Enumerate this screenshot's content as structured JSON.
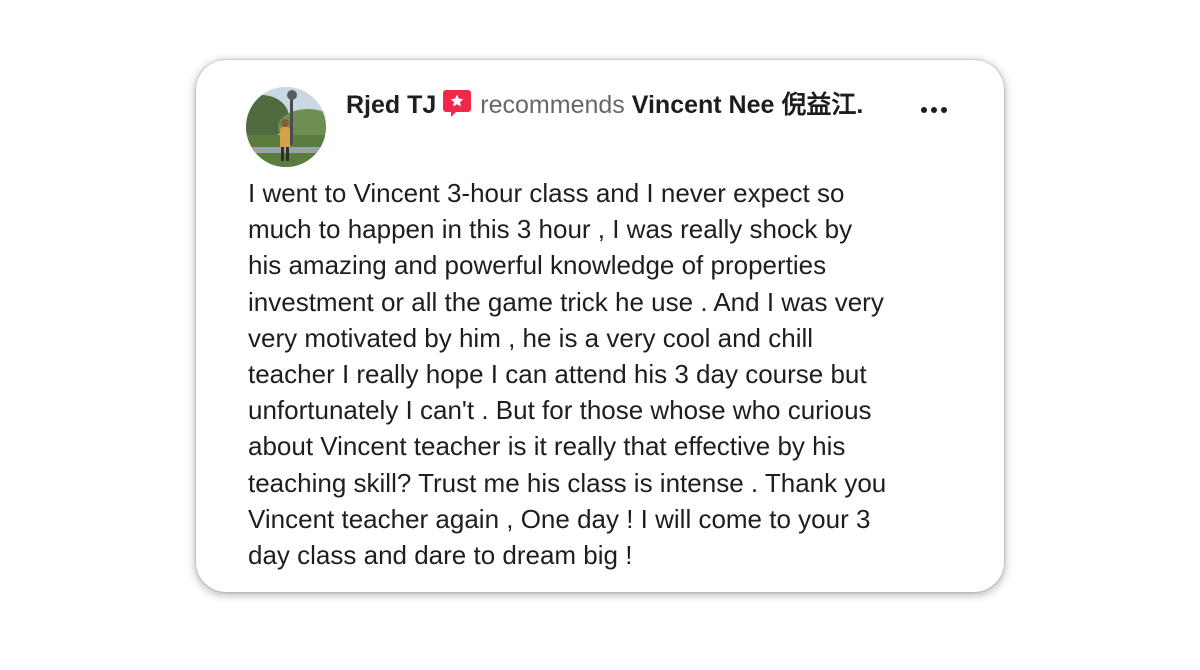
{
  "post": {
    "author": "Rjed TJ",
    "verb": "recommends",
    "page_name": "Vincent Nee 倪益江.",
    "text": "I went to Vincent 3-hour class and I never expect so\nmuch to happen in this 3 hour , I was really shock by\nhis amazing and powerful knowledge of properties\ninvestment or all the game trick he use . And I was very\nvery motivated by him , he is a very cool and chill\nteacher I really hope I can attend his 3 day course but\nunfortunately I can't . But for those whose who curious\nabout Vincent teacher is it really that effective by his\nteaching skill? Trust me his class is intense . Thank you\nVincent teacher again , One day ! I will come to your 3\nday class and dare to dream big !"
  },
  "icons": {
    "recommend": "recommend-star-icon",
    "more": "more-options-icon"
  },
  "colors": {
    "recommend_icon": "#f02849",
    "text_primary": "#1c1e21",
    "text_secondary": "#65676b"
  }
}
